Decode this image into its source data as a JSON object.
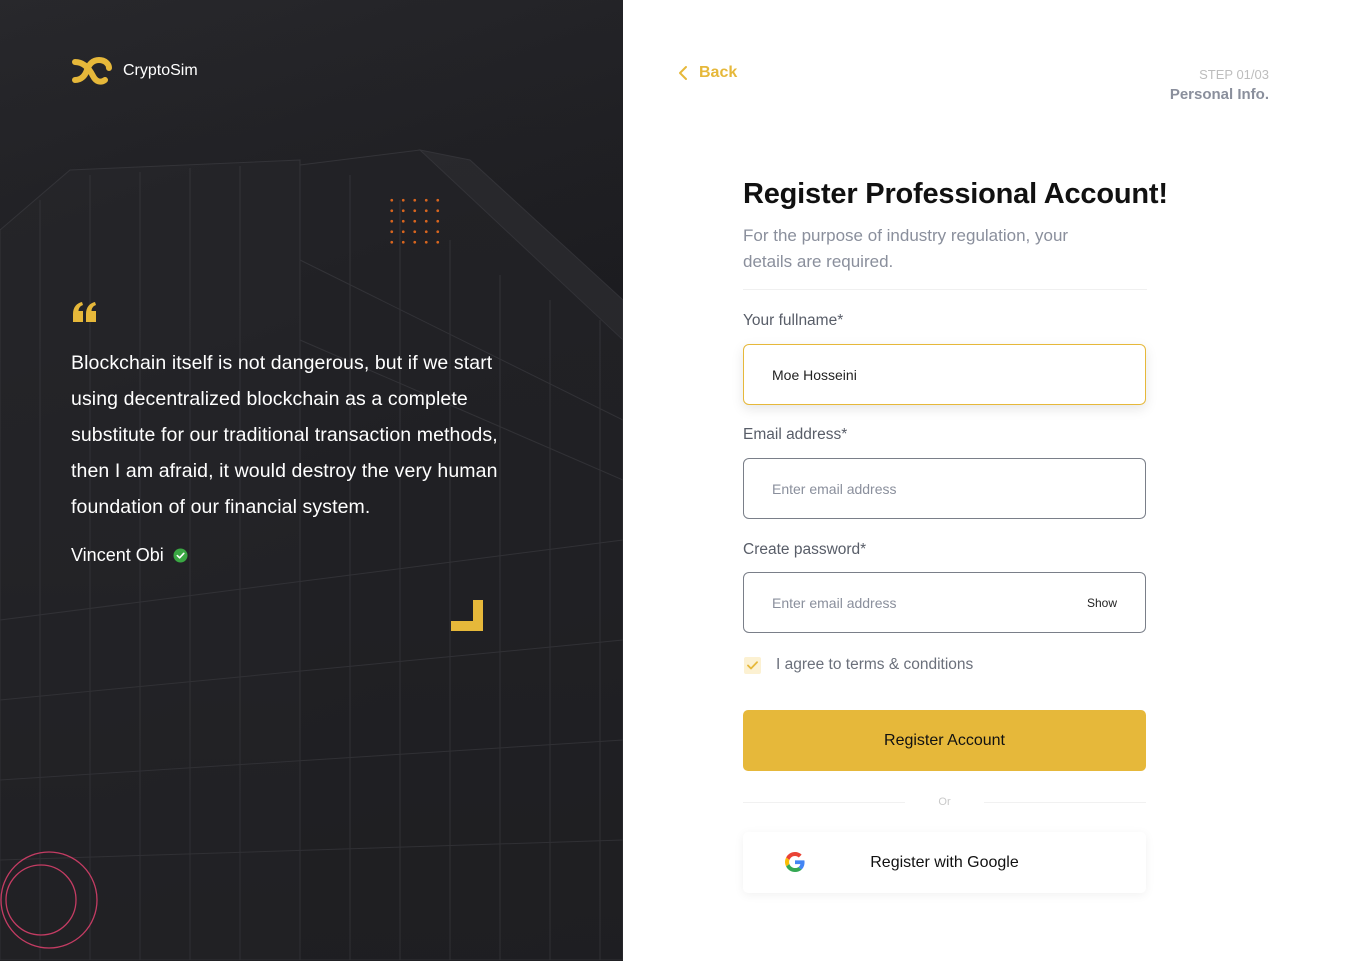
{
  "brand": {
    "name": "CryptoSim",
    "icon": "cryptosim-logo-icon",
    "accent": "#e6b83a"
  },
  "testimonial": {
    "quote": "Blockchain itself is not dangerous, but if we start using decentralized blockchain as a complete substitute for our traditional transaction methods, then I am afraid, it would destroy the very human foundation of our financial system.",
    "author": "Vincent Obi",
    "verified_icon": "verified-check-icon",
    "verified_color": "#3aa843"
  },
  "nav": {
    "back_label": "Back"
  },
  "step": {
    "number": "STEP 01/03",
    "name": "Personal Info."
  },
  "form": {
    "title": "Register Professional Account!",
    "subtitle": "For the purpose of industry regulation, your details are required.",
    "fullname": {
      "label": "Your fullname*",
      "value": "Moe Hosseini"
    },
    "email": {
      "label": "Email address*",
      "placeholder": "Enter email address"
    },
    "password": {
      "label": "Create password*",
      "placeholder": "Enter email address",
      "show_label": "Show"
    },
    "agree_label": "I agree to terms & conditions",
    "agree_checked": true,
    "register_label": "Register Account",
    "or_label": "Or",
    "google_label": "Register with Google"
  }
}
